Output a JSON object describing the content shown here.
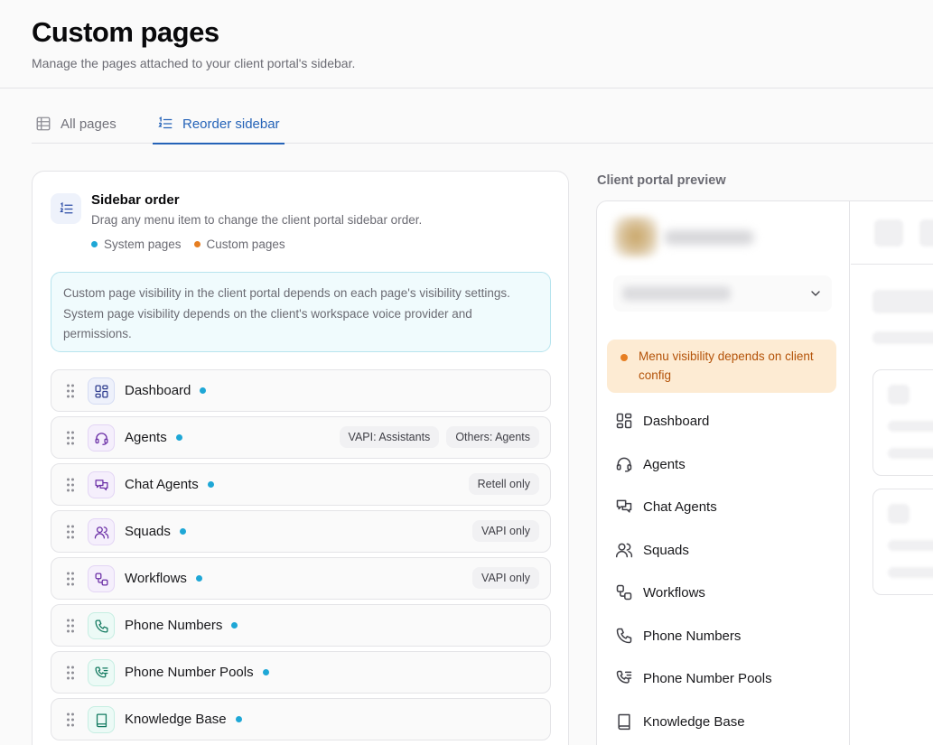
{
  "header": {
    "title": "Custom pages",
    "subtitle": "Manage the pages attached to your client portal's sidebar."
  },
  "tabs": [
    {
      "label": "All pages",
      "icon": "table-icon",
      "active": false
    },
    {
      "label": "Reorder sidebar",
      "icon": "list-ordered-icon",
      "active": true
    }
  ],
  "sidebar_order": {
    "title": "Sidebar order",
    "description": "Drag any menu item to change the client portal sidebar order.",
    "legend": {
      "system": "System pages",
      "custom": "Custom pages"
    },
    "info": "Custom page visibility in the client portal depends on each page's visibility settings. System page visibility depends on the client's workspace voice provider and permissions.",
    "items": [
      {
        "label": "Dashboard",
        "icon": "layout-grid-icon",
        "badges": []
      },
      {
        "label": "Agents",
        "icon": "headset-icon",
        "badges": [
          "VAPI: Assistants",
          "Others: Agents"
        ]
      },
      {
        "label": "Chat Agents",
        "icon": "chat-bubbles-icon",
        "badges": [
          "Retell only"
        ]
      },
      {
        "label": "Squads",
        "icon": "users-icon",
        "badges": [
          "VAPI only"
        ]
      },
      {
        "label": "Workflows",
        "icon": "workflow-icon",
        "badges": [
          "VAPI only"
        ]
      },
      {
        "label": "Phone Numbers",
        "icon": "phone-icon",
        "badges": []
      },
      {
        "label": "Phone Number Pools",
        "icon": "phone-list-icon",
        "badges": []
      },
      {
        "label": "Knowledge Base",
        "icon": "book-icon",
        "badges": []
      }
    ]
  },
  "preview": {
    "title": "Client portal preview",
    "warning": "Menu visibility depends on client config",
    "items": [
      "Dashboard",
      "Agents",
      "Chat Agents",
      "Squads",
      "Workflows",
      "Phone Numbers",
      "Phone Number Pools",
      "Knowledge Base"
    ]
  },
  "colors": {
    "accent": "#2563b8",
    "system_dot": "#1ea7d6",
    "custom_dot": "#e67e22",
    "warning_bg": "#fdebd3"
  }
}
